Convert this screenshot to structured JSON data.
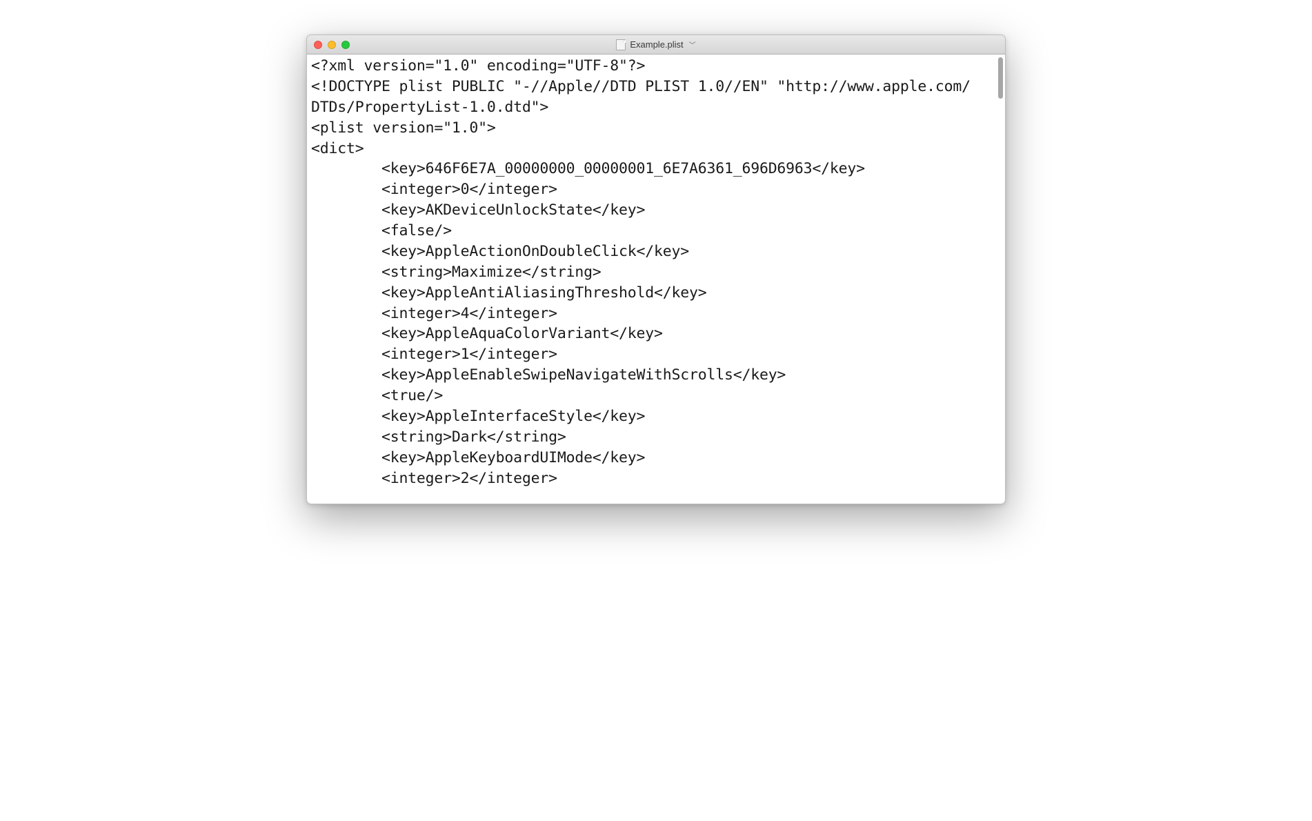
{
  "window": {
    "title": "Example.plist"
  },
  "content": {
    "lines": [
      "<?xml version=\"1.0\" encoding=\"UTF-8\"?>",
      "<!DOCTYPE plist PUBLIC \"-//Apple//DTD PLIST 1.0//EN\" \"http://www.apple.com/",
      "DTDs/PropertyList-1.0.dtd\">",
      "<plist version=\"1.0\">",
      "<dict>",
      "        <key>646F6E7A_00000000_00000001_6E7A6361_696D6963</key>",
      "        <integer>0</integer>",
      "        <key>AKDeviceUnlockState</key>",
      "        <false/>",
      "        <key>AppleActionOnDoubleClick</key>",
      "        <string>Maximize</string>",
      "        <key>AppleAntiAliasingThreshold</key>",
      "        <integer>4</integer>",
      "        <key>AppleAquaColorVariant</key>",
      "        <integer>1</integer>",
      "        <key>AppleEnableSwipeNavigateWithScrolls</key>",
      "        <true/>",
      "        <key>AppleInterfaceStyle</key>",
      "        <string>Dark</string>",
      "        <key>AppleKeyboardUIMode</key>",
      "        <integer>2</integer>"
    ]
  }
}
